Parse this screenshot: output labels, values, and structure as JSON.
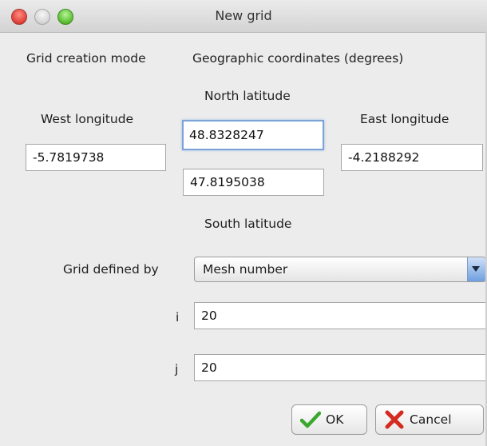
{
  "window": {
    "title": "New grid"
  },
  "form": {
    "mode_label": "Grid creation mode",
    "mode_value": "Geographic coordinates (degrees)",
    "north_label": "North latitude",
    "north_value": "48.8328247",
    "south_label": "South latitude",
    "south_value": "47.8195038",
    "west_label": "West longitude",
    "west_value": "-5.7819738",
    "east_label": "East longitude",
    "east_value": "-4.2188292",
    "grid_defined_label": "Grid defined by",
    "grid_defined_value": "Mesh number",
    "i_label": "i",
    "i_value": "20",
    "j_label": "j",
    "j_value": "20"
  },
  "buttons": {
    "ok": "OK",
    "cancel": "Cancel"
  },
  "icons": {
    "ok": "checkmark-icon",
    "cancel": "x-icon",
    "dropdown": "chevron-down-icon"
  },
  "colors": {
    "ok_check": "#3aa82f",
    "cancel_x": "#d42a1f",
    "focus": "#7da2d6"
  }
}
